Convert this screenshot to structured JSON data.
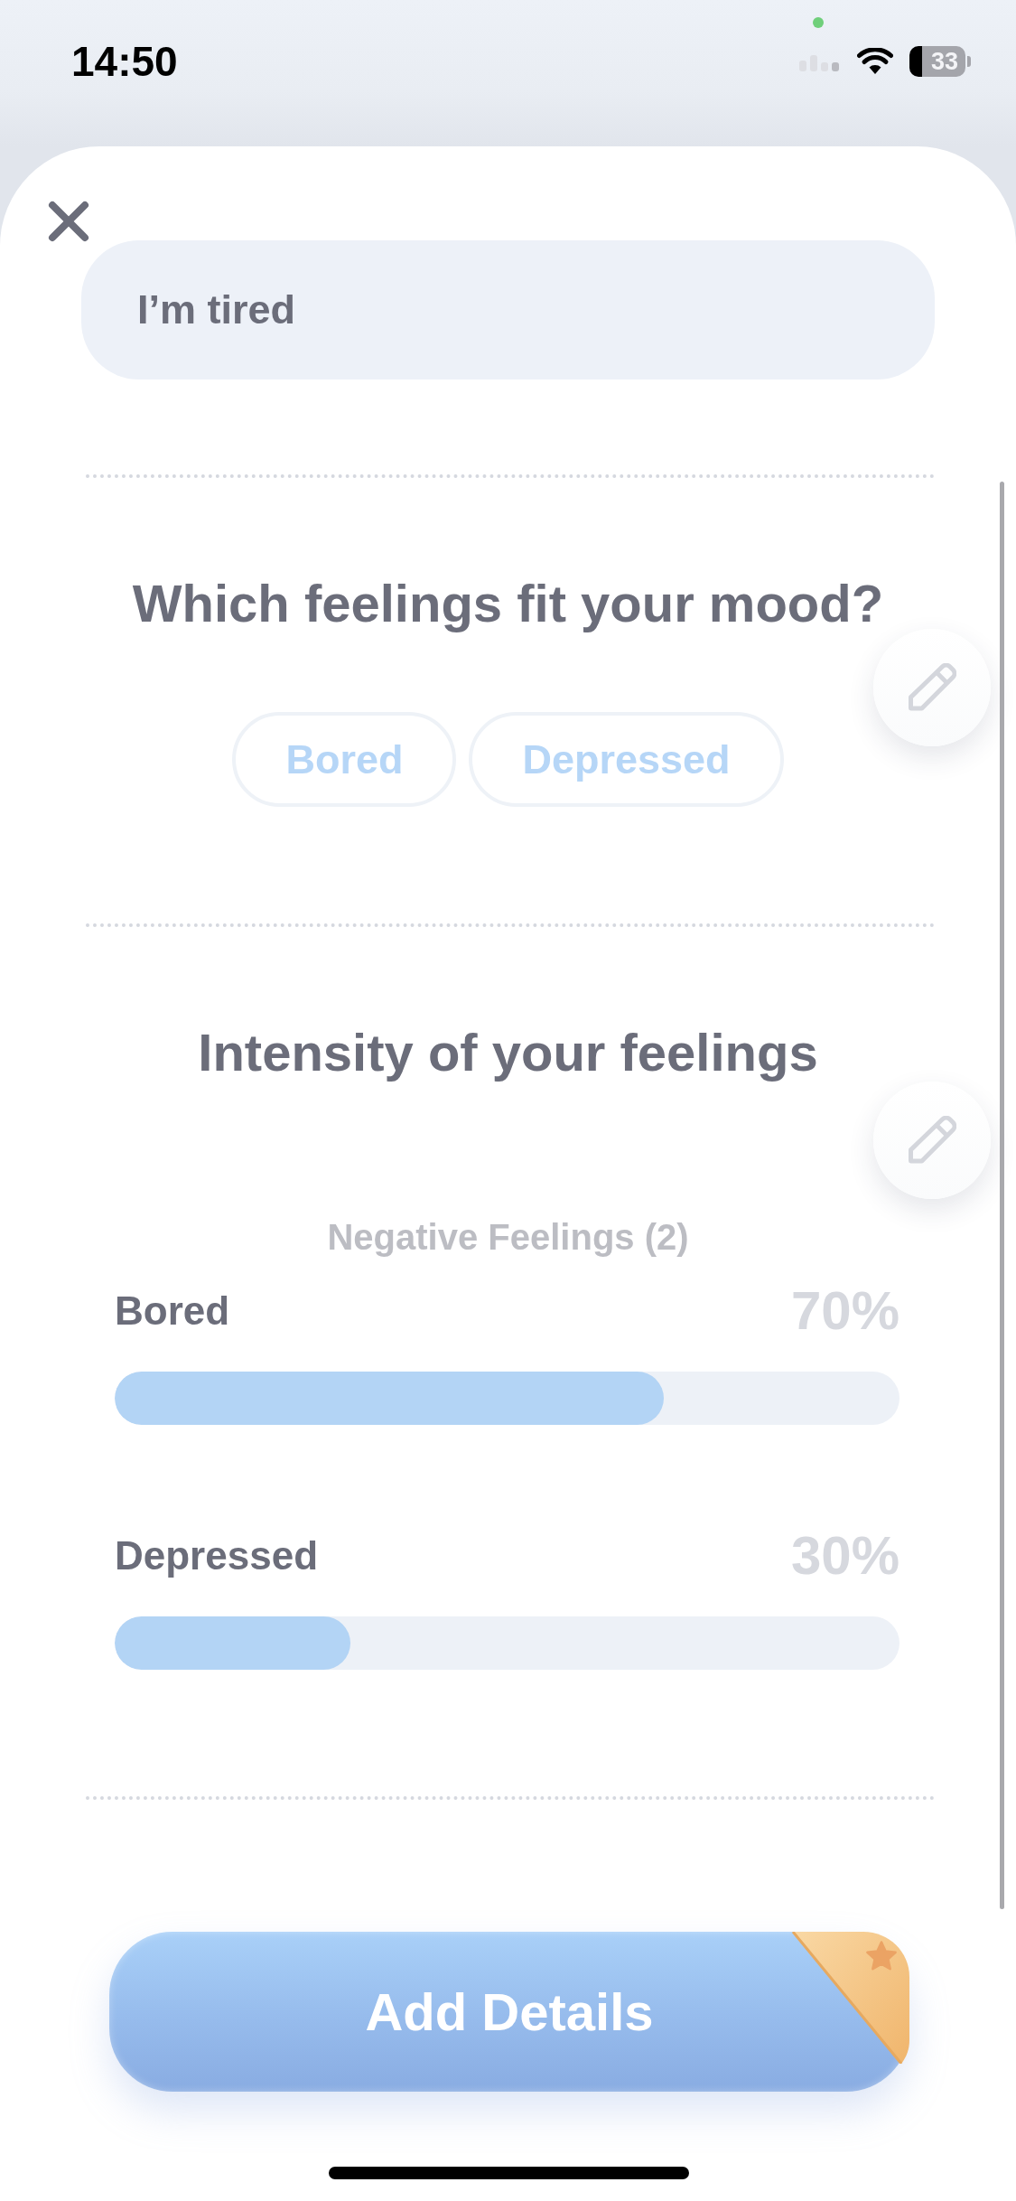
{
  "status_bar": {
    "time": "14:50",
    "battery": "33"
  },
  "note_field": {
    "value": "I’m tired"
  },
  "feelings_section": {
    "title": "Which feelings fit your mood?",
    "chips": [
      {
        "label": "Bored"
      },
      {
        "label": "Depressed"
      }
    ]
  },
  "intensity_section": {
    "title": "Intensity of your feelings",
    "group_label": "Negative Feelings (2)",
    "feelings": [
      {
        "name": "Bored",
        "reading": "70%",
        "level": 0.7
      },
      {
        "name": "Depressed",
        "reading": "30%",
        "level": 0.3
      }
    ]
  },
  "primary_button": {
    "label": "Add Details"
  }
}
